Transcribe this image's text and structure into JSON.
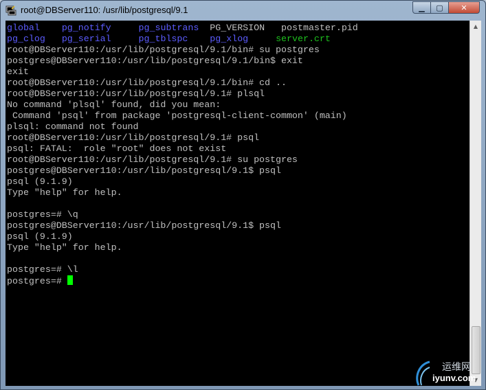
{
  "window": {
    "title": "root@DBServer110: /usr/lib/postgresql/9.1",
    "minimize": "▁",
    "maximize": "▢",
    "close": "✕"
  },
  "terminal": {
    "colors": {
      "dir_blue": "#5c5cff",
      "dir_green": "#1ec01e",
      "text": "#c0c0c0",
      "cursor": "#00ff00",
      "background": "#000000"
    },
    "ls_row1": [
      "global",
      "pg_notify",
      "pg_subtrans",
      "PG_VERSION",
      "postmaster.pid"
    ],
    "ls_row2": [
      "pg_clog",
      "pg_serial",
      "pg_tblspc",
      "pg_xlog",
      "server.crt"
    ],
    "lines": [
      "root@DBServer110:/usr/lib/postgresql/9.1/bin# su postgres",
      "postgres@DBServer110:/usr/lib/postgresql/9.1/bin$ exit",
      "exit",
      "root@DBServer110:/usr/lib/postgresql/9.1/bin# cd ..",
      "root@DBServer110:/usr/lib/postgresql/9.1# plsql",
      "No command 'plsql' found, did you mean:",
      " Command 'psql' from package 'postgresql-client-common' (main)",
      "plsql: command not found",
      "root@DBServer110:/usr/lib/postgresql/9.1# psql",
      "psql: FATAL:  role \"root\" does not exist",
      "root@DBServer110:/usr/lib/postgresql/9.1# su postgres",
      "postgres@DBServer110:/usr/lib/postgresql/9.1$ psql",
      "psql (9.1.9)",
      "Type \"help\" for help.",
      "",
      "postgres=# \\q",
      "postgres@DBServer110:/usr/lib/postgresql/9.1$ psql",
      "psql (9.1.9)",
      "Type \"help\" for help.",
      "",
      "postgres=# \\l",
      "postgres=# "
    ]
  },
  "scrollbar": {
    "up_icon": "up-arrow-icon",
    "down_icon": "down-arrow-icon"
  },
  "watermark": {
    "text_cn": "运维网",
    "text_url": "iyunv.com"
  }
}
